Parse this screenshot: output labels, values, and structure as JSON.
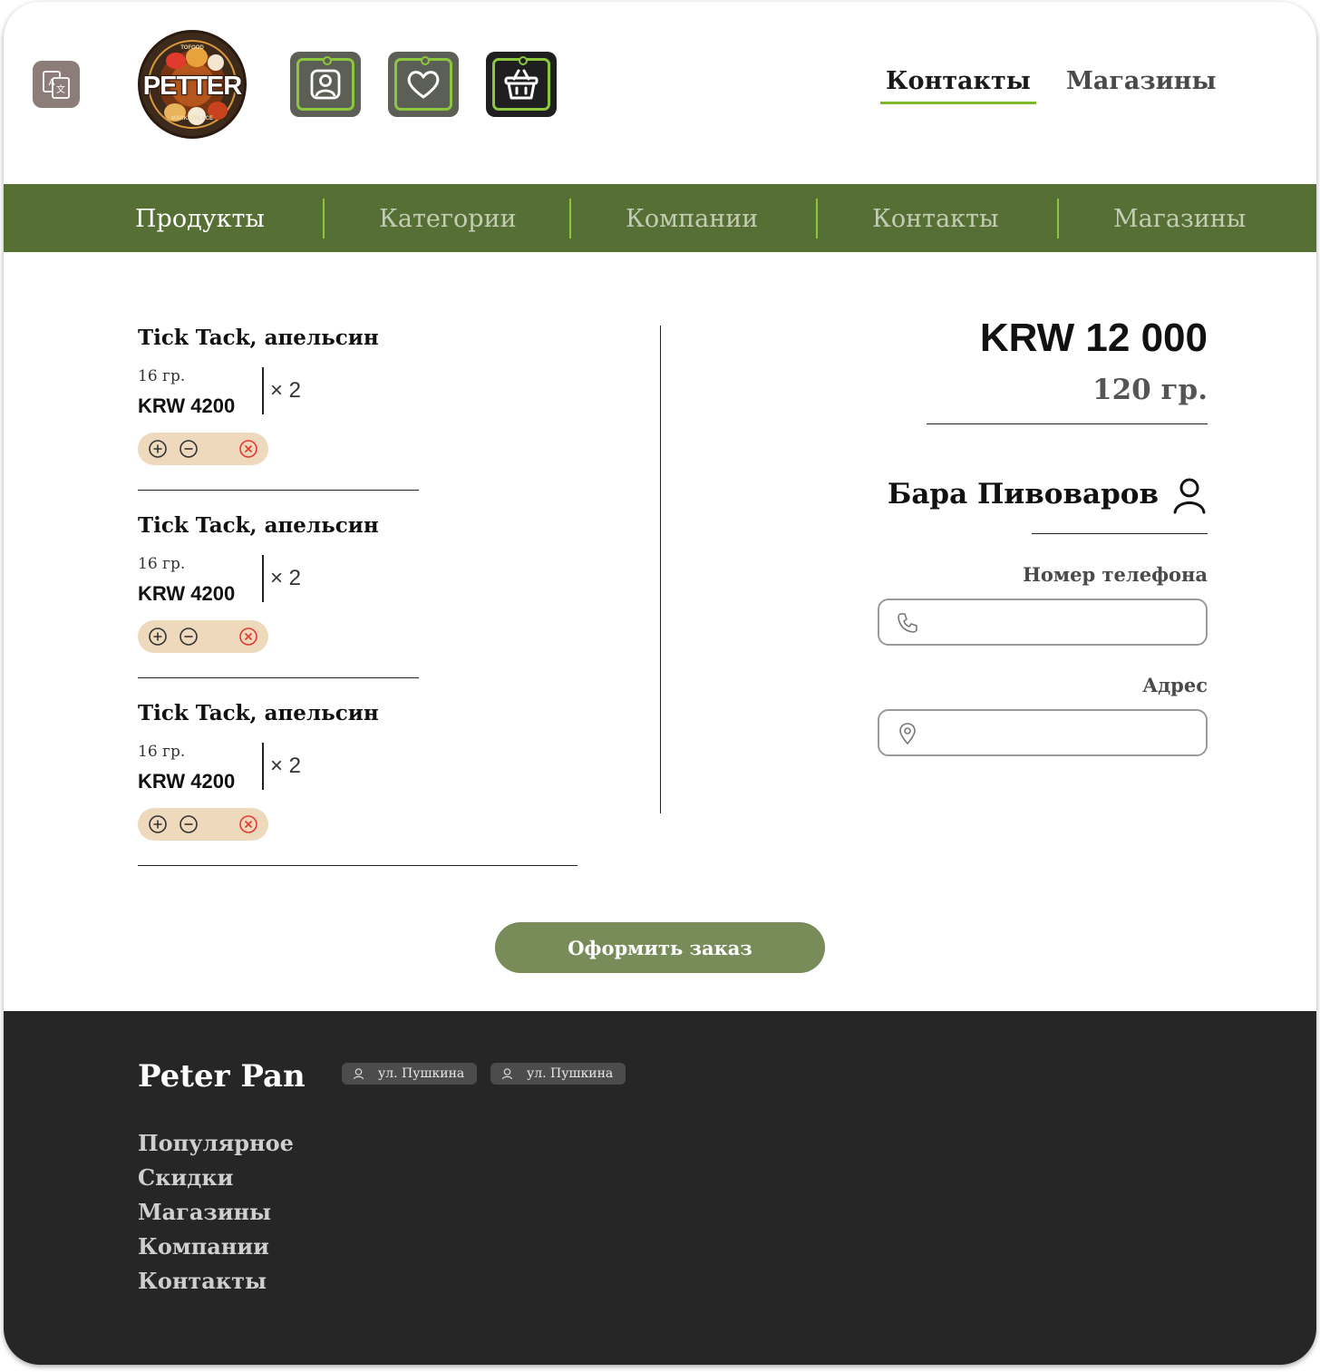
{
  "header": {
    "logo": {
      "main": "PETTER",
      "top": "TOFOOD",
      "bottom": "MARKETPLACE"
    },
    "links": [
      {
        "label": "Контакты",
        "active": true
      },
      {
        "label": "Магазины",
        "active": false
      }
    ]
  },
  "nav": {
    "items": [
      "Продукты",
      "Категории",
      "Компании",
      "Контакты",
      "Магазины"
    ],
    "active_index": 0
  },
  "cart": {
    "items": [
      {
        "name": "Tick Tack, апельсин",
        "weight": "16 гр.",
        "price": "KRW 4200",
        "qty": "× 2"
      },
      {
        "name": "Tick Tack, апельсин",
        "weight": "16 гр.",
        "price": "KRW 4200",
        "qty": "× 2"
      },
      {
        "name": "Tick Tack, апельсин",
        "weight": "16 гр.",
        "price": "KRW 4200",
        "qty": "× 2"
      }
    ]
  },
  "summary": {
    "total_price": "KRW 12 000",
    "total_weight": "120 гр.",
    "customer_name": "Бара Пивоваров",
    "phone_label": "Номер телефона",
    "phone_value": "",
    "address_label": "Адрес",
    "address_value": ""
  },
  "checkout": {
    "label": "Оформить заказ"
  },
  "footer": {
    "brand": "Peter Pan",
    "addresses": [
      "ул. Пушкина",
      "ул. Пушкина"
    ],
    "links": [
      "Популярное",
      "Скидки",
      "Магазины",
      "Компании",
      "Контакты"
    ]
  },
  "colors": {
    "nav_bg": "#556f35",
    "accent": "#8cc63f",
    "checkout_bg": "#778c59",
    "footer_bg": "#262626",
    "control_bg": "#efd9bd",
    "remove": "#e53935"
  },
  "icons": [
    "translate-icon",
    "profile-icon",
    "heart-icon",
    "basket-icon",
    "plus-circle-icon",
    "minus-circle-icon",
    "remove-circle-icon",
    "user-icon",
    "phone-icon",
    "location-pin-icon"
  ]
}
